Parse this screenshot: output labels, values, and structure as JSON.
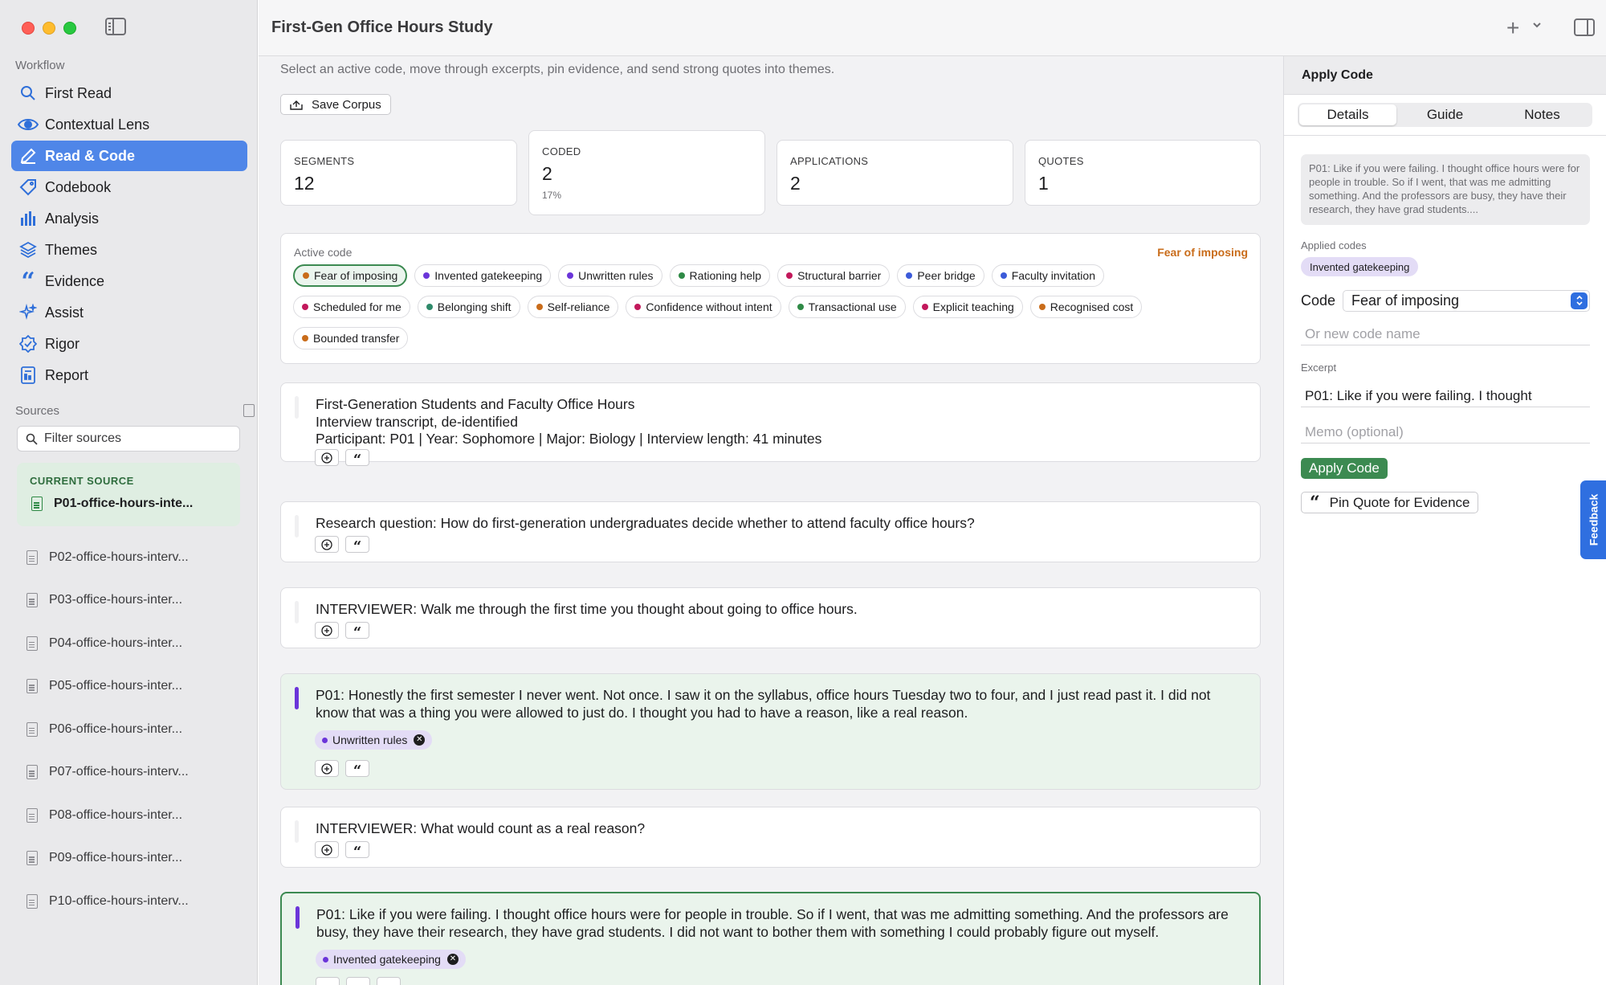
{
  "window": {
    "title": "First-Gen Office Hours Study"
  },
  "sidebar": {
    "workflow_label": "Workflow",
    "nav": [
      {
        "label": "First Read",
        "icon": "search-doc-icon"
      },
      {
        "label": "Contextual Lens",
        "icon": "eye-icon"
      },
      {
        "label": "Read & Code",
        "icon": "pencil-icon",
        "active": true
      },
      {
        "label": "Codebook",
        "icon": "tag-icon"
      },
      {
        "label": "Analysis",
        "icon": "bar-chart-icon"
      },
      {
        "label": "Themes",
        "icon": "layers-icon"
      },
      {
        "label": "Evidence",
        "icon": "quote-icon"
      },
      {
        "label": "Assist",
        "icon": "sparkle-icon"
      },
      {
        "label": "Rigor",
        "icon": "check-badge-icon"
      },
      {
        "label": "Report",
        "icon": "report-icon"
      }
    ],
    "sources_label": "Sources",
    "filter_placeholder": "Filter sources",
    "current_source_label": "CURRENT SOURCE",
    "current_source": "P01-office-hours-inte...",
    "sources": [
      "P02-office-hours-interv...",
      "P03-office-hours-inter...",
      "P04-office-hours-inter...",
      "P05-office-hours-inter...",
      "P06-office-hours-inter...",
      "P07-office-hours-interv...",
      "P08-office-hours-inter...",
      "P09-office-hours-inter...",
      "P10-office-hours-interv..."
    ]
  },
  "main": {
    "subtitle": "Select an active code, move through excerpts, pin evidence, and send strong quotes into themes.",
    "save_label": "Save Corpus",
    "stats": {
      "segments": {
        "label": "SEGMENTS",
        "value": "12"
      },
      "coded": {
        "label": "CODED",
        "value": "2",
        "sub": "17%"
      },
      "applications": {
        "label": "APPLICATIONS",
        "value": "2"
      },
      "quotes": {
        "label": "QUOTES",
        "value": "1"
      }
    },
    "active_code_label": "Active code",
    "active_code_current": "Fear of imposing",
    "codes_row1": [
      {
        "label": "Fear of imposing",
        "color": "#c96c1a",
        "selected": true
      },
      {
        "label": "Invented gatekeeping",
        "color": "#6b35d9"
      },
      {
        "label": "Unwritten rules",
        "color": "#6b35d9"
      },
      {
        "label": "Rationing help",
        "color": "#2f8a46"
      },
      {
        "label": "Structural barrier",
        "color": "#c2185b"
      },
      {
        "label": "Peer bridge",
        "color": "#3c5bd9"
      },
      {
        "label": "Faculty invitation",
        "color": "#3c5bd9"
      }
    ],
    "codes_row2": [
      {
        "label": "Scheduled for me",
        "color": "#c2185b"
      },
      {
        "label": "Belonging shift",
        "color": "#2f8a6a"
      },
      {
        "label": "Self-reliance",
        "color": "#c96c1a"
      },
      {
        "label": "Confidence without intent",
        "color": "#c2185b"
      },
      {
        "label": "Transactional use",
        "color": "#2f8a46"
      },
      {
        "label": "Explicit teaching",
        "color": "#c2185b"
      },
      {
        "label": "Recognised cost",
        "color": "#c96c1a"
      }
    ],
    "codes_row3": [
      {
        "label": "Bounded transfer",
        "color": "#c96c1a"
      }
    ],
    "excerpts": [
      {
        "lines": [
          "First-Generation Students and Faculty Office Hours",
          "Interview transcript, de-identified",
          "Participant: P01 | Year: Sophomore | Major: Biology | Interview length: 41 minutes"
        ]
      },
      {
        "lines": [
          "Research question: How do first-generation undergraduates decide whether to attend faculty office hours?"
        ]
      },
      {
        "lines": [
          "INTERVIEWER: Walk me through the first time you thought about going to office hours."
        ]
      },
      {
        "lines": [
          "P01: Honestly the first semester I never went. Not once. I saw it on the syllabus, office hours Tuesday two to four, and I just read past it. I did not know that was a thing you were allowed to just do. I thought you had to have a reason, like a real reason."
        ],
        "tag": "Unwritten rules"
      },
      {
        "lines": [
          "INTERVIEWER: What would count as a real reason?"
        ]
      },
      {
        "lines": [
          "P01: Like if you were failing. I thought office hours were for people in trouble. So if I went, that was me admitting something. And the professors are busy, they have their research, they have grad students. I did not want to bother them with something I could probably figure out myself."
        ],
        "tag": "Invented gatekeeping"
      }
    ]
  },
  "right_panel": {
    "title": "Apply Code",
    "tabs": [
      "Details",
      "Guide",
      "Notes"
    ],
    "preview": "P01: Like if you were failing. I thought office hours were for people in trouble. So if I went, that was me admitting something. And the professors are busy, they have their research, they have grad students....",
    "applied_codes_label": "Applied codes",
    "applied_code": "Invented gatekeeping",
    "code_label": "Code",
    "code_value": "Fear of imposing",
    "new_code_placeholder": "Or new code name",
    "excerpt_label": "Excerpt",
    "excerpt_value": "P01: Like if you were failing. I thought",
    "memo_placeholder": "Memo (optional)",
    "apply_label": "Apply Code",
    "pin_label": "Pin Quote for Evidence",
    "feedback_label": "Feedback"
  },
  "colors": {
    "accent": "#4f86e8",
    "green": "#3c8a51",
    "purple": "#6b35d9",
    "orange": "#c96c1a"
  }
}
